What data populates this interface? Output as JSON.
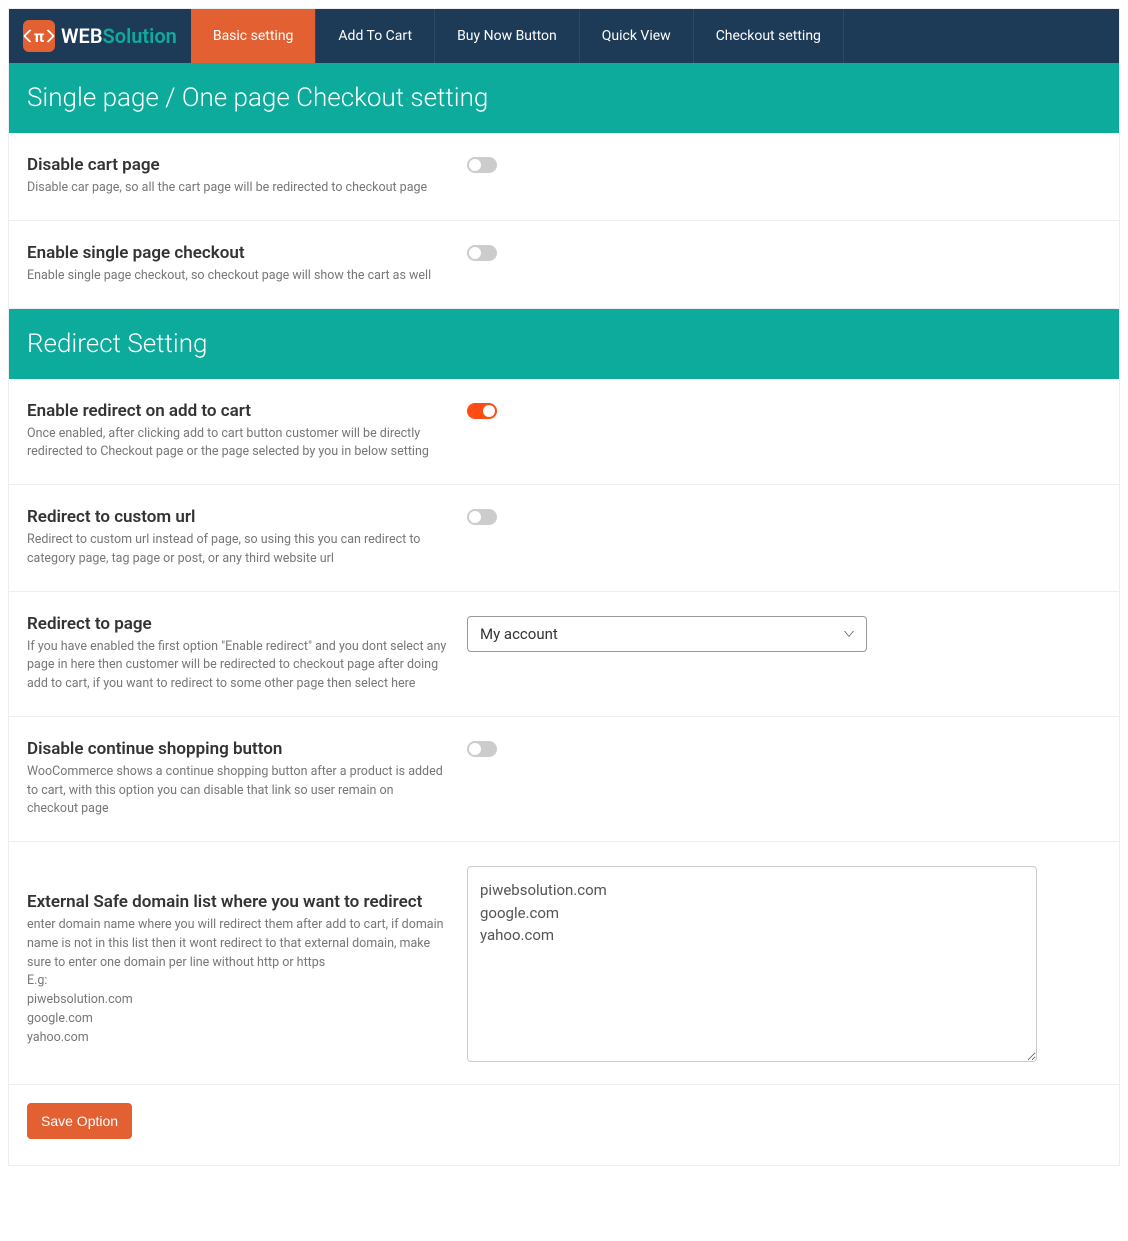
{
  "logo": {
    "symbol": "π",
    "text1": "WEB",
    "text2": "Solution"
  },
  "tabs": [
    {
      "label": "Basic setting",
      "active": true
    },
    {
      "label": "Add To Cart",
      "active": false
    },
    {
      "label": "Buy Now Button",
      "active": false
    },
    {
      "label": "Quick View",
      "active": false
    },
    {
      "label": "Checkout setting",
      "active": false
    }
  ],
  "sections": {
    "checkout": {
      "header": "Single page / One page Checkout setting",
      "settings": {
        "disable_cart": {
          "title": "Disable cart page",
          "desc": "Disable car page, so all the cart page will be redirected to checkout page",
          "state": "off"
        },
        "enable_single": {
          "title": "Enable single page checkout",
          "desc": "Enable single page checkout, so checkout page will show the cart as well",
          "state": "off"
        }
      }
    },
    "redirect": {
      "header": "Redirect Setting",
      "settings": {
        "enable_redirect": {
          "title": "Enable redirect on add to cart",
          "desc": "Once enabled, after clicking add to cart button customer will be directly redirected to Checkout page or the page selected by you in below setting",
          "state": "on"
        },
        "custom_url": {
          "title": "Redirect to custom url",
          "desc": "Redirect to custom url instead of page, so using this you can redirect to category page, tag page or post, or any third website url",
          "state": "off"
        },
        "redirect_page": {
          "title": "Redirect to page",
          "desc": "If you have enabled the first option \"Enable redirect\" and you dont select any page in here then customer will be redirected to checkout page after doing add to cart, if you want to redirect to some other page then select here",
          "selected": "My account"
        },
        "disable_continue": {
          "title": "Disable continue shopping button",
          "desc": "WooCommerce shows a continue shopping button after a product is added to cart, with this option you can disable that link so user remain on checkout page",
          "state": "off"
        },
        "external_domains": {
          "title": "External Safe domain list where you want to redirect",
          "desc": "enter domain name where you will redirect them after add to cart, if domain name is not in this list then it wont redirect to that external domain, make sure to enter one domain per line without http or https",
          "example_label": "E.g:",
          "example1": "piwebsolution.com",
          "example2": "google.com",
          "example3": "yahoo.com",
          "value": "piwebsolution.com\ngoogle.com\nyahoo.com"
        }
      }
    }
  },
  "footer": {
    "save_label": "Save Option"
  }
}
